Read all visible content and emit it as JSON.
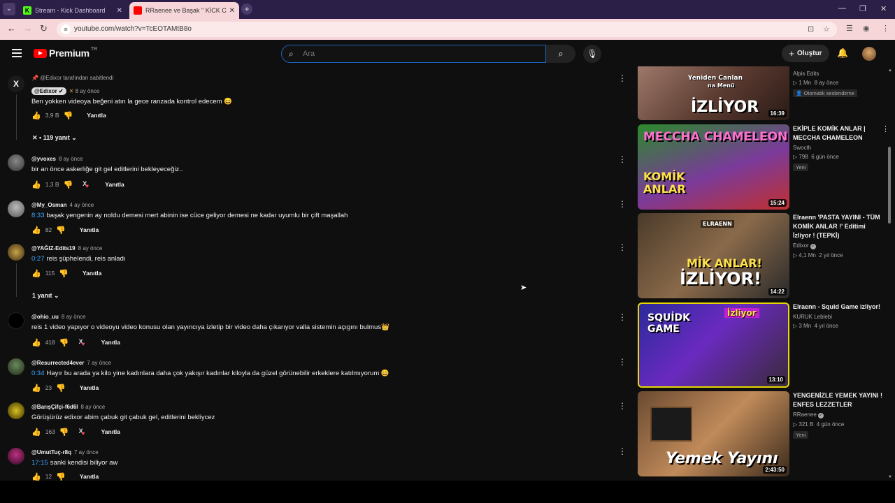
{
  "browser": {
    "tabs": [
      {
        "title": "Stream - Kick Dashboard",
        "favicon_color": "#53fc18",
        "favicon_text": "K"
      },
      {
        "title": "RRaenee ve Başak \" KİCK CHAT",
        "favicon_color": "#ff0000"
      }
    ],
    "url": "youtube.com/watch?v=TcEOTAMtB8o"
  },
  "header": {
    "logo_text": "Premium",
    "logo_region": "TR",
    "search_placeholder": "Ara",
    "create_label": "Oluştur"
  },
  "comments": [
    {
      "pinned_text": "@Edixor tarafından sabitlendi",
      "author": "@Edixor",
      "time": "8 ay önce",
      "text": "Ben yokken videoya beğeni atın la gece ranzada kontrol edecem 😄",
      "likes": "3,9 B",
      "reply_label": "Yanıtla",
      "replies_label": "• 119 yanıt"
    },
    {
      "author": "@yvoxes",
      "time": "8 ay önce",
      "text": "bir an önce askerliğe git gel editlerini bekleyeceğiz..",
      "likes": "1,3 B",
      "reply_label": "Yanıtla"
    },
    {
      "author": "@My_Osman",
      "time": "4 ay önce",
      "timestamp": "8:33",
      "text": "başak yengenin ay noldu demesi mert abinin ise cüce geliyor demesi ne kadar uyumlu bir çift maşallah",
      "likes": "82",
      "reply_label": "Yanıtla"
    },
    {
      "author": "@YAĞIZ-Edits19",
      "time": "8 ay önce",
      "timestamp": "0:27",
      "text": "reis şüphelendi, reis anladı",
      "likes": "115",
      "reply_label": "Yanıtla",
      "replies_label": "1 yanıt"
    },
    {
      "author": "@ohio_uu",
      "time": "8 ay önce",
      "text": "reis 1 video yapıyor o videoyu video konusu olan yayıncıya izletip bir video daha çıkarıyor valla sistemin açıgını bulmus👑",
      "likes": "418",
      "reply_label": "Yanıtla"
    },
    {
      "author": "@Resurrected4ever",
      "time": "7 ay önce",
      "timestamp": "0:34",
      "text": "Hayır bu arada ya kilo yine kadınlara daha çok yakışır kadınlar kiloyla da güzel görünebilir erkeklere katılmıyorum 😄",
      "likes": "23",
      "reply_label": "Yanıtla"
    },
    {
      "author": "@BarışÇifçi-f6d6l",
      "time": "8 ay önce",
      "text": "Görüşürüz edixor abim çabuk git çabuk gel, editlerini bekliycez",
      "likes": "163",
      "reply_label": "Yanıtla"
    },
    {
      "author": "@UmutTuç-r8q",
      "time": "7 ay önce",
      "timestamp": "17:15",
      "text": "sanki kendisi biliyor aw",
      "likes": "12",
      "reply_label": "Yanıtla"
    }
  ],
  "sidebar": [
    {
      "title": "",
      "channel": "Alpis Edits",
      "views": "1 Mn",
      "age": "8 ay önce",
      "badge": "Otomatik seslendirme",
      "duration": "16:39",
      "caption_top": "Yeniden Canlan",
      "caption_mid": "na Menü",
      "caption": "İZLİYOR"
    },
    {
      "title": "EKİPLE KOMİK ANLAR | MECCHA CHAMELEON",
      "channel": "Swocth",
      "views": "798",
      "age": "6 gün önce",
      "badge": "Yeni",
      "duration": "15:24",
      "caption_top": "MECCHA CHAMELEON",
      "caption": "KOMİK ANLAR"
    },
    {
      "title": "Elraenn 'PASTA YAYINI - TÜM KOMİK ANLAR !' Editimi İzliyor ! (TEPKİ)",
      "channel": "Edixor",
      "views": "4,1 Mn",
      "age": "2 yıl önce",
      "duration": "14:22",
      "caption_top": "MİK ANLAR!",
      "caption": "İZLİYOR!"
    },
    {
      "title": "Elraenn - Squid Game izliyor!",
      "channel": "KURUK Leblebi",
      "views": "3 Mn",
      "age": "4 yıl önce",
      "duration": "13:10",
      "caption_top": "SQUİDK GAME",
      "caption": "İzliyor"
    },
    {
      "title": "YENGENİZLE YEMEK YAYINI ! ENFES LEZZETLER",
      "channel": "RRaenee",
      "views": "321 B",
      "age": "4 gün önce",
      "badge": "Yeni",
      "duration": "2:43:50",
      "caption": "Yemek Yayını"
    }
  ],
  "colors": {
    "accent_link": "#3ea6ff",
    "youtube_red": "#ff0000",
    "tab_active": "#f6d6d8",
    "tabstrip": "#2b1f47"
  }
}
